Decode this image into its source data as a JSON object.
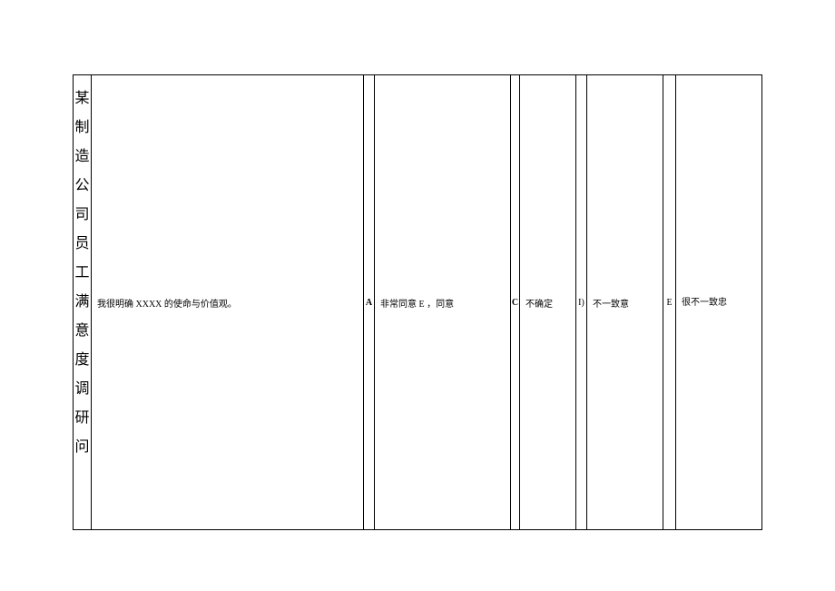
{
  "title": "某制造公司员工满意度调研问",
  "row": {
    "question": "我很明确 XXXX 的使命与价值观。",
    "optA_marker": "A",
    "optAB_text": "非常同意 E ，同意",
    "optC_marker": "C",
    "optC_text": "不确定",
    "optD_marker": "I)",
    "optD_text": "不一致意",
    "optE_marker": "E",
    "optE_text": "很不一致忠"
  }
}
